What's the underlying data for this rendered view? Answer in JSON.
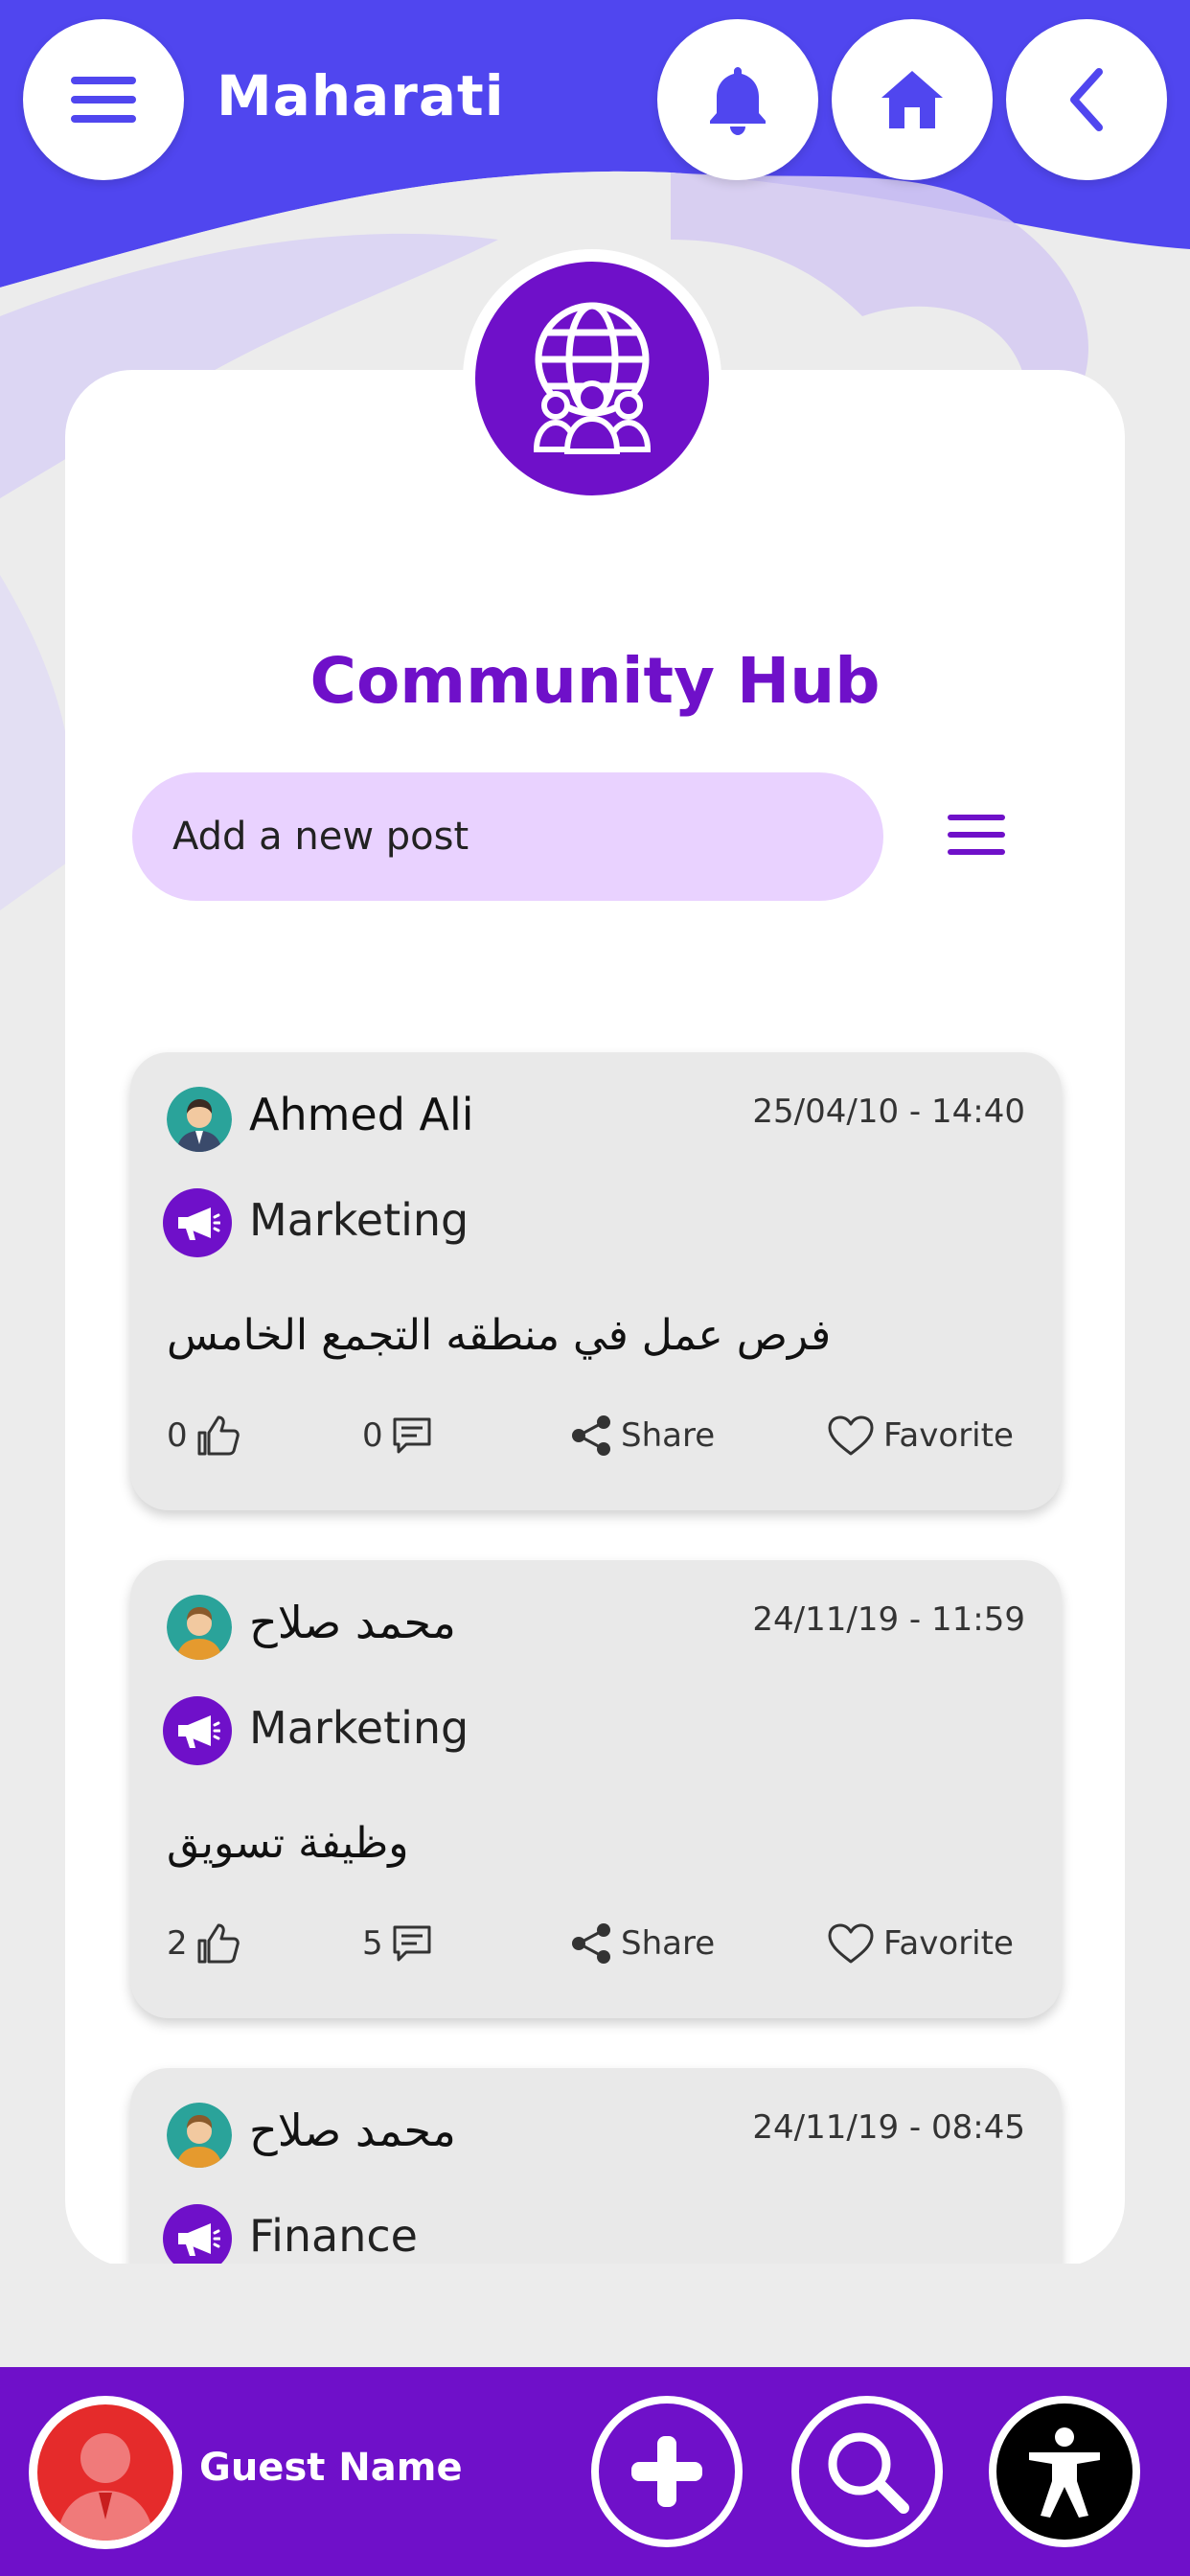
{
  "header": {
    "title": "Maharati",
    "menu_icon": "hamburger-menu-icon",
    "notifications_icon": "bell-icon",
    "home_icon": "home-icon",
    "back_icon": "chevron-left-icon"
  },
  "hub": {
    "logo_icon": "globe-community-icon",
    "title": "Community Hub",
    "new_post_placeholder": "Add a new post",
    "filter_icon": "hamburger-menu-icon"
  },
  "posts": [
    {
      "author": "Ahmed Ali",
      "date": "25/04/10 - 14:40",
      "category": "Marketing",
      "text": "فرص عمل في منطقه التجمع الخامس",
      "likes": "0",
      "comments": "0",
      "share_label": "Share",
      "favorite_label": "Favorite"
    },
    {
      "author": "محمد صلاح",
      "date": "24/11/19 - 11:59",
      "category": "Marketing",
      "text": "وظيفة تسويق",
      "likes": "2",
      "comments": "5",
      "share_label": "Share",
      "favorite_label": "Favorite"
    },
    {
      "author": "محمد صلاح",
      "date": "24/11/19 - 08:45",
      "category": "Finance"
    }
  ],
  "footer": {
    "guest_name": "Guest Name",
    "add_icon": "plus-icon",
    "search_icon": "search-icon",
    "accessibility_icon": "accessibility-icon"
  },
  "colors": {
    "header_blue": "#5046ef",
    "accent_purple": "#6f10c9",
    "input_lavender": "#e9d2ff",
    "card_gray": "#e9e9e9"
  }
}
